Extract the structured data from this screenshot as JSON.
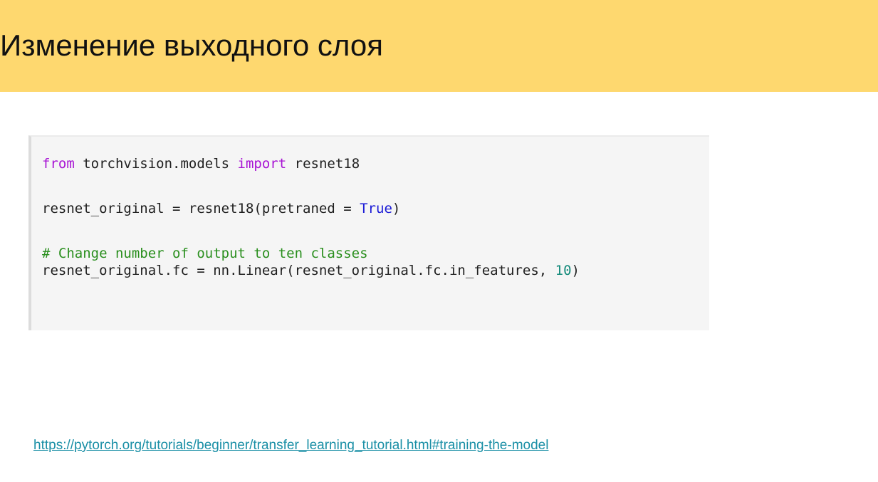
{
  "slide": {
    "title": "Изменение выходного слоя"
  },
  "code": {
    "line1": {
      "kw_from": "from",
      "module": " torchvision.models ",
      "kw_import": "import",
      "name": " resnet18"
    },
    "line2": {
      "prefix": "resnet_original = resnet18(pretraned = ",
      "bool": "True",
      "suffix": ")"
    },
    "line3": {
      "comment": "# Change number of output to ten classes"
    },
    "line4": {
      "prefix": "resnet_original.fc = nn.Linear(resnet_original.fc.in_features, ",
      "number": "10",
      "suffix": ")"
    }
  },
  "reference": {
    "url": "https://pytorch.org/tutorials/beginner/transfer_learning_tutorial.html#training-the-model"
  },
  "colors": {
    "title_bar": "#fed86f",
    "keyword": "#a814d4",
    "boolean": "#1a1ad6",
    "number": "#138a7a",
    "comment": "#2a8f1e",
    "link": "#1a8fa6"
  }
}
